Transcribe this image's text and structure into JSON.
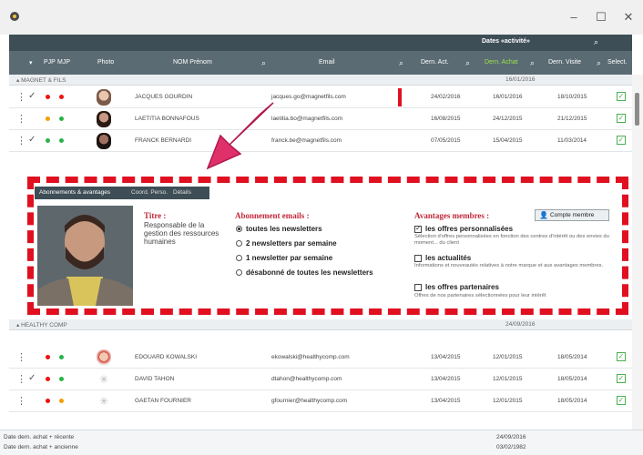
{
  "header": {
    "dates_title": "Dates «activité»",
    "columns": {
      "plp": "PJP",
      "mjp": "MJP",
      "photo": "Photo",
      "name": "NOM Prénom",
      "email": "Email",
      "dern_act": "Dern. Act.",
      "dern_achat": "Dern. Achat",
      "dern_visite": "Dern. Visite",
      "select": "Select."
    }
  },
  "groups": [
    {
      "name": "MAGNET & FILS",
      "date": "16/01/2016"
    },
    {
      "name": "HEALTHY COMP",
      "date": "24/09/2016"
    }
  ],
  "rows_a": [
    {
      "name": "JACQUES GOURDIN",
      "email": "jacques.go@magnetfils.com",
      "d1": "24/02/2016",
      "d2": "16/01/2016",
      "d3": "18/10/2015"
    },
    {
      "name": "LAETITIA BONNAFOUS",
      "email": "laetitia.bo@magnetfils.com",
      "d1": "16/08/2015",
      "d2": "24/12/2015",
      "d3": "21/12/2015"
    },
    {
      "name": "FRANCK BERNARDI",
      "email": "franck.be@magnetfils.com",
      "d1": "07/05/2015",
      "d2": "15/04/2015",
      "d3": "11/03/2014"
    }
  ],
  "rows_b": [
    {
      "name": "EDOUARD KOWALSKI",
      "email": "ekowalski@healthycomp.com",
      "d1": "13/04/2015",
      "d2": "12/01/2015",
      "d3": "18/05/2014"
    },
    {
      "name": "DAVID TAHON",
      "email": "dtahon@healthycomp.com",
      "d1": "13/04/2015",
      "d2": "12/01/2015",
      "d3": "18/05/2014"
    },
    {
      "name": "GAETAN FOURNIER",
      "email": "gfournier@healthycomp.com",
      "d1": "13/04/2015",
      "d2": "12/01/2015",
      "d3": "18/05/2014"
    }
  ],
  "detail": {
    "tabs": [
      "Abonnements & avantages",
      "Coord. Perso.",
      "Détails"
    ],
    "title_label": "Titre :",
    "title_value": "Responsable de la gestion des ressources humaines",
    "subs_title": "Abonnement emails :",
    "options": [
      "toutes les newsletters",
      "2 newsletters par semaine",
      "1 newsletter par semaine",
      "désabonné de toutes les newsletters"
    ],
    "adv_title": "Avantages membres :",
    "compte_btn": "Compte membre",
    "advantages": [
      {
        "label": "les offres personnalisées",
        "desc": "Sélection d'offres personnalisées en fonction des centres d'intérêt ou des envies du moment... du client",
        "checked": true
      },
      {
        "label": "les actualités",
        "desc": "Informations et nouveautés relatives à notre marque et aux avantages membres.",
        "checked": false
      },
      {
        "label": "les offres partenaires",
        "desc": "Offres de nos partenaires sélectionnées pour leur intérêt",
        "checked": false
      }
    ]
  },
  "footer": {
    "left1": "Date dern. achat + récente",
    "left2": "Date dern. achat + ancienne",
    "right1": "24/09/2016",
    "right2": "03/02/1982"
  }
}
